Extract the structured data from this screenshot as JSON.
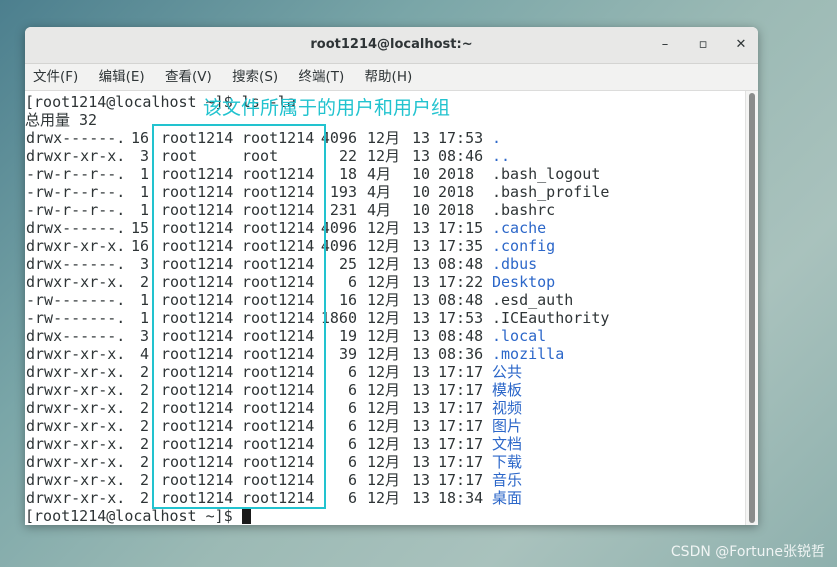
{
  "window": {
    "title": "root1214@localhost:~"
  },
  "menu": [
    "文件(F)",
    "编辑(E)",
    "查看(V)",
    "搜索(S)",
    "终端(T)",
    "帮助(H)"
  ],
  "terminal": {
    "command_line": "[root1214@localhost ~]$ ls -la",
    "total_line": "总用量 32",
    "rows": [
      {
        "perm": "drwx------.",
        "links": "16",
        "owner": "root1214",
        "group": "root1214",
        "size": "4096",
        "month": "12月",
        "day": "13",
        "time": "17:53",
        "name": ".",
        "color": "blue"
      },
      {
        "perm": "drwxr-xr-x.",
        "links": "3",
        "owner": "root",
        "group": "root",
        "size": "22",
        "month": "12月",
        "day": "13",
        "time": "08:46",
        "name": "..",
        "color": "blue"
      },
      {
        "perm": "-rw-r--r--.",
        "links": "1",
        "owner": "root1214",
        "group": "root1214",
        "size": "18",
        "month": "4月",
        "day": "10",
        "time": "2018",
        "name": ".bash_logout",
        "color": "plain"
      },
      {
        "perm": "-rw-r--r--.",
        "links": "1",
        "owner": "root1214",
        "group": "root1214",
        "size": "193",
        "month": "4月",
        "day": "10",
        "time": "2018",
        "name": ".bash_profile",
        "color": "plain"
      },
      {
        "perm": "-rw-r--r--.",
        "links": "1",
        "owner": "root1214",
        "group": "root1214",
        "size": "231",
        "month": "4月",
        "day": "10",
        "time": "2018",
        "name": ".bashrc",
        "color": "plain"
      },
      {
        "perm": "drwx------.",
        "links": "15",
        "owner": "root1214",
        "group": "root1214",
        "size": "4096",
        "month": "12月",
        "day": "13",
        "time": "17:15",
        "name": ".cache",
        "color": "blue"
      },
      {
        "perm": "drwxr-xr-x.",
        "links": "16",
        "owner": "root1214",
        "group": "root1214",
        "size": "4096",
        "month": "12月",
        "day": "13",
        "time": "17:35",
        "name": ".config",
        "color": "blue"
      },
      {
        "perm": "drwx------.",
        "links": "3",
        "owner": "root1214",
        "group": "root1214",
        "size": "25",
        "month": "12月",
        "day": "13",
        "time": "08:48",
        "name": ".dbus",
        "color": "blue"
      },
      {
        "perm": "drwxr-xr-x.",
        "links": "2",
        "owner": "root1214",
        "group": "root1214",
        "size": "6",
        "month": "12月",
        "day": "13",
        "time": "17:22",
        "name": "Desktop",
        "color": "blue"
      },
      {
        "perm": "-rw-------.",
        "links": "1",
        "owner": "root1214",
        "group": "root1214",
        "size": "16",
        "month": "12月",
        "day": "13",
        "time": "08:48",
        "name": ".esd_auth",
        "color": "plain"
      },
      {
        "perm": "-rw-------.",
        "links": "1",
        "owner": "root1214",
        "group": "root1214",
        "size": "1860",
        "month": "12月",
        "day": "13",
        "time": "17:53",
        "name": ".ICEauthority",
        "color": "plain"
      },
      {
        "perm": "drwx------.",
        "links": "3",
        "owner": "root1214",
        "group": "root1214",
        "size": "19",
        "month": "12月",
        "day": "13",
        "time": "08:48",
        "name": ".local",
        "color": "blue"
      },
      {
        "perm": "drwxr-xr-x.",
        "links": "4",
        "owner": "root1214",
        "group": "root1214",
        "size": "39",
        "month": "12月",
        "day": "13",
        "time": "08:36",
        "name": ".mozilla",
        "color": "blue"
      },
      {
        "perm": "drwxr-xr-x.",
        "links": "2",
        "owner": "root1214",
        "group": "root1214",
        "size": "6",
        "month": "12月",
        "day": "13",
        "time": "17:17",
        "name": "公共",
        "color": "blue"
      },
      {
        "perm": "drwxr-xr-x.",
        "links": "2",
        "owner": "root1214",
        "group": "root1214",
        "size": "6",
        "month": "12月",
        "day": "13",
        "time": "17:17",
        "name": "模板",
        "color": "blue"
      },
      {
        "perm": "drwxr-xr-x.",
        "links": "2",
        "owner": "root1214",
        "group": "root1214",
        "size": "6",
        "month": "12月",
        "day": "13",
        "time": "17:17",
        "name": "视频",
        "color": "blue"
      },
      {
        "perm": "drwxr-xr-x.",
        "links": "2",
        "owner": "root1214",
        "group": "root1214",
        "size": "6",
        "month": "12月",
        "day": "13",
        "time": "17:17",
        "name": "图片",
        "color": "blue"
      },
      {
        "perm": "drwxr-xr-x.",
        "links": "2",
        "owner": "root1214",
        "group": "root1214",
        "size": "6",
        "month": "12月",
        "day": "13",
        "time": "17:17",
        "name": "文档",
        "color": "blue"
      },
      {
        "perm": "drwxr-xr-x.",
        "links": "2",
        "owner": "root1214",
        "group": "root1214",
        "size": "6",
        "month": "12月",
        "day": "13",
        "time": "17:17",
        "name": "下载",
        "color": "blue"
      },
      {
        "perm": "drwxr-xr-x.",
        "links": "2",
        "owner": "root1214",
        "group": "root1214",
        "size": "6",
        "month": "12月",
        "day": "13",
        "time": "17:17",
        "name": "音乐",
        "color": "blue"
      },
      {
        "perm": "drwxr-xr-x.",
        "links": "2",
        "owner": "root1214",
        "group": "root1214",
        "size": "6",
        "month": "12月",
        "day": "13",
        "time": "18:34",
        "name": "桌面",
        "color": "blue"
      }
    ],
    "prompt_line": "[root1214@localhost ~]$ "
  },
  "annotation": {
    "label": "该文件所属于的用户和用户组",
    "color": "#22c3cf"
  },
  "watermark": "CSDN @Fortune张锐哲"
}
